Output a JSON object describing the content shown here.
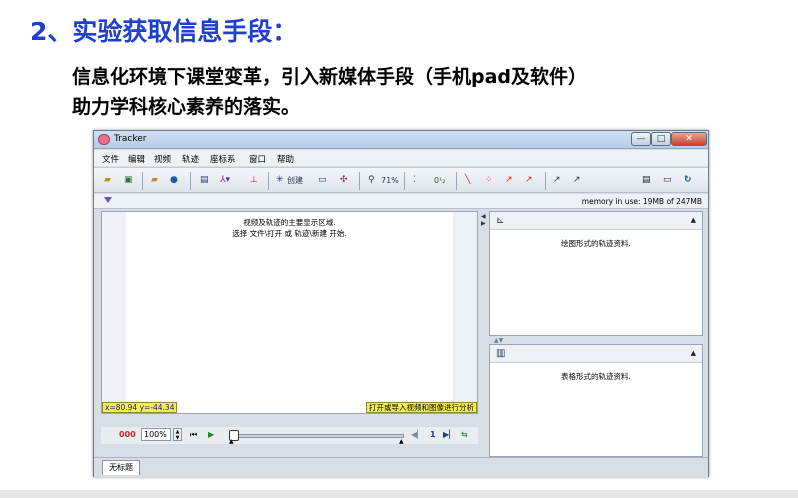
{
  "slide": {
    "title": "2、实验获取信息手段：",
    "subtitle_line1": "信息化环境下课堂变革，引入新媒体手段（手机pad及软件）",
    "subtitle_line2": "助力学科核心素养的落实。"
  },
  "window": {
    "title": "Tracker",
    "controls": {
      "minimize": "—",
      "maximize": "□",
      "close": "✕"
    }
  },
  "menu": [
    "文件",
    "编辑",
    "视频",
    "轨迹",
    "座标系",
    "窗口",
    "帮助"
  ],
  "toolbar": {
    "create_label": "创建",
    "zoom_label": "71%",
    "icons": [
      "open-folder",
      "save",
      "open-video",
      "record",
      "clip-settings",
      "coordinate-axes",
      "calibration",
      "create",
      "tape-measure",
      "calibration-points",
      "zoom",
      "track-points",
      "trails",
      "vector",
      "velocity",
      "acceleration",
      "paths",
      "autotracker",
      "notes",
      "video-info",
      "refresh"
    ]
  },
  "status": {
    "memory": "memory in use: 19MB of 247MB"
  },
  "video_pane": {
    "line1": "视频及轨迹的主要显示区域.",
    "line2": "选择 文件\\打开 或 轨迹\\新建 开始.",
    "coords": "x=80.94  y=-44.34",
    "hint": "打开或导入视频和图像进行分析"
  },
  "plot_panel": {
    "message": "绘图形式的轨迹资料."
  },
  "table_panel": {
    "message": "表格形式的轨迹资料."
  },
  "player": {
    "frame": "000",
    "rate": "100%",
    "step_value": "1"
  },
  "tabs": [
    "无标题"
  ],
  "colors": {
    "title_blue": "#1f3fd0",
    "highlight_yellow": "#f6ef4a",
    "frame_red": "#d32222"
  }
}
